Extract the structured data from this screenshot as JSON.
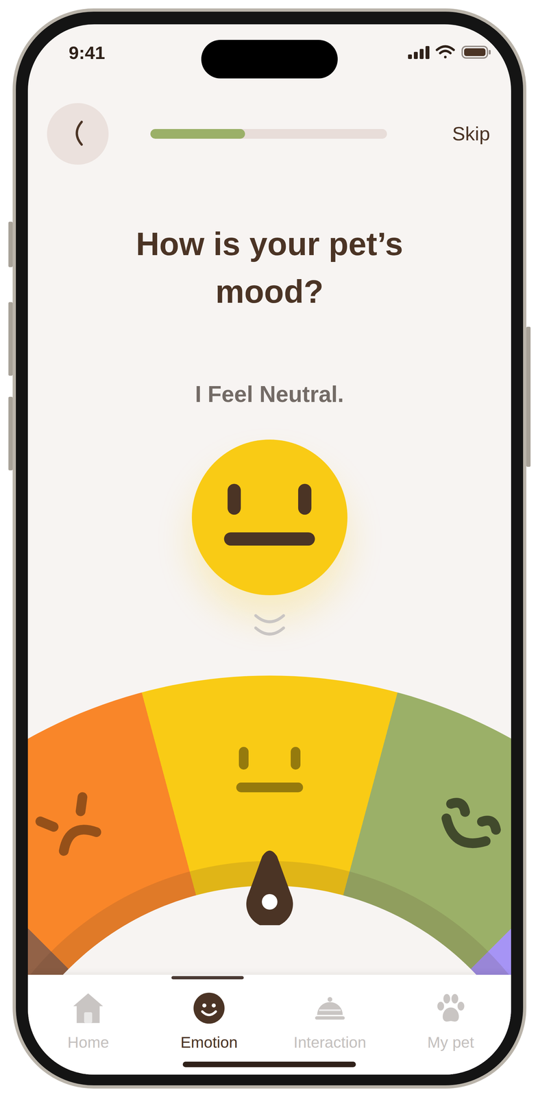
{
  "status_bar": {
    "time": "9:41"
  },
  "header": {
    "progress": {
      "level": 0.4
    },
    "skip": "Skip"
  },
  "question": {
    "title": "How is your pet’s mood?",
    "answer": "I Feel Neutral."
  },
  "gauge": {
    "segments": [
      {
        "kind": "depressed",
        "color": "#926247",
        "selected": false
      },
      {
        "kind": "sad",
        "color": "#F98629",
        "selected": false
      },
      {
        "kind": "neutral",
        "color": "#F9CB15",
        "selected": true
      },
      {
        "kind": "happy",
        "color": "#9BB068",
        "selected": false
      },
      {
        "kind": "overjoyed",
        "color": "#A694F5",
        "selected": false
      }
    ]
  },
  "tabs": [
    {
      "label": "Home",
      "selected": false
    },
    {
      "label": "Emotion",
      "selected": true
    },
    {
      "label": "Interaction",
      "selected": false
    },
    {
      "label": "My pet",
      "selected": false
    }
  ]
}
